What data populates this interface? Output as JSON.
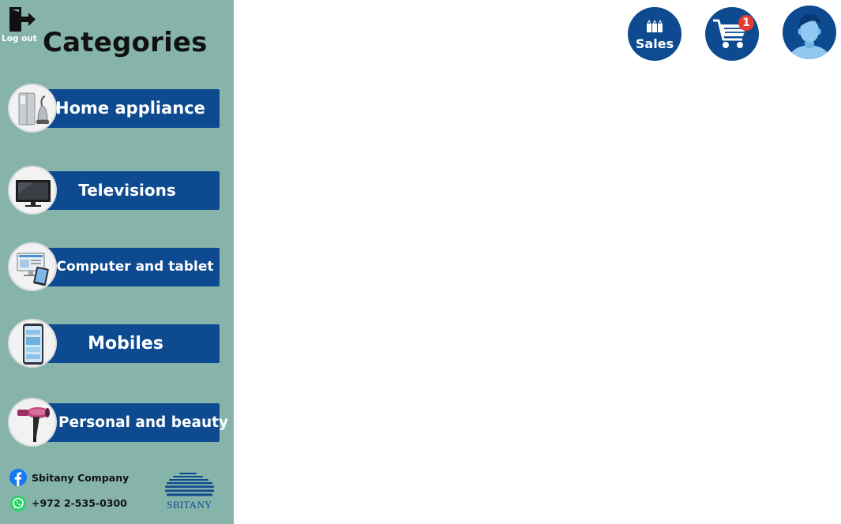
{
  "sidebar": {
    "logout_label": "Log out",
    "title": "Categories",
    "categories": [
      {
        "label": "Home appliance"
      },
      {
        "label": "Televisions"
      },
      {
        "label": "Computer and tablet"
      },
      {
        "label": "Mobiles"
      },
      {
        "label": "Personal and beauty"
      }
    ],
    "footer": {
      "facebook_text": "Sbitany Company",
      "whatsapp_text": "+972 2-535-0300",
      "brand_text": "SBITANY"
    }
  },
  "header": {
    "sales_label": "Sales",
    "cart_count": "1"
  },
  "colors": {
    "sidebar_bg": "#87b4aa",
    "accent_blue": "#0d4a8f",
    "badge_red": "#e53a2f"
  },
  "icons": [
    "logout-icon",
    "sales-tags-icon",
    "shopping-cart-icon",
    "user-avatar-icon",
    "facebook-icon",
    "whatsapp-icon"
  ]
}
